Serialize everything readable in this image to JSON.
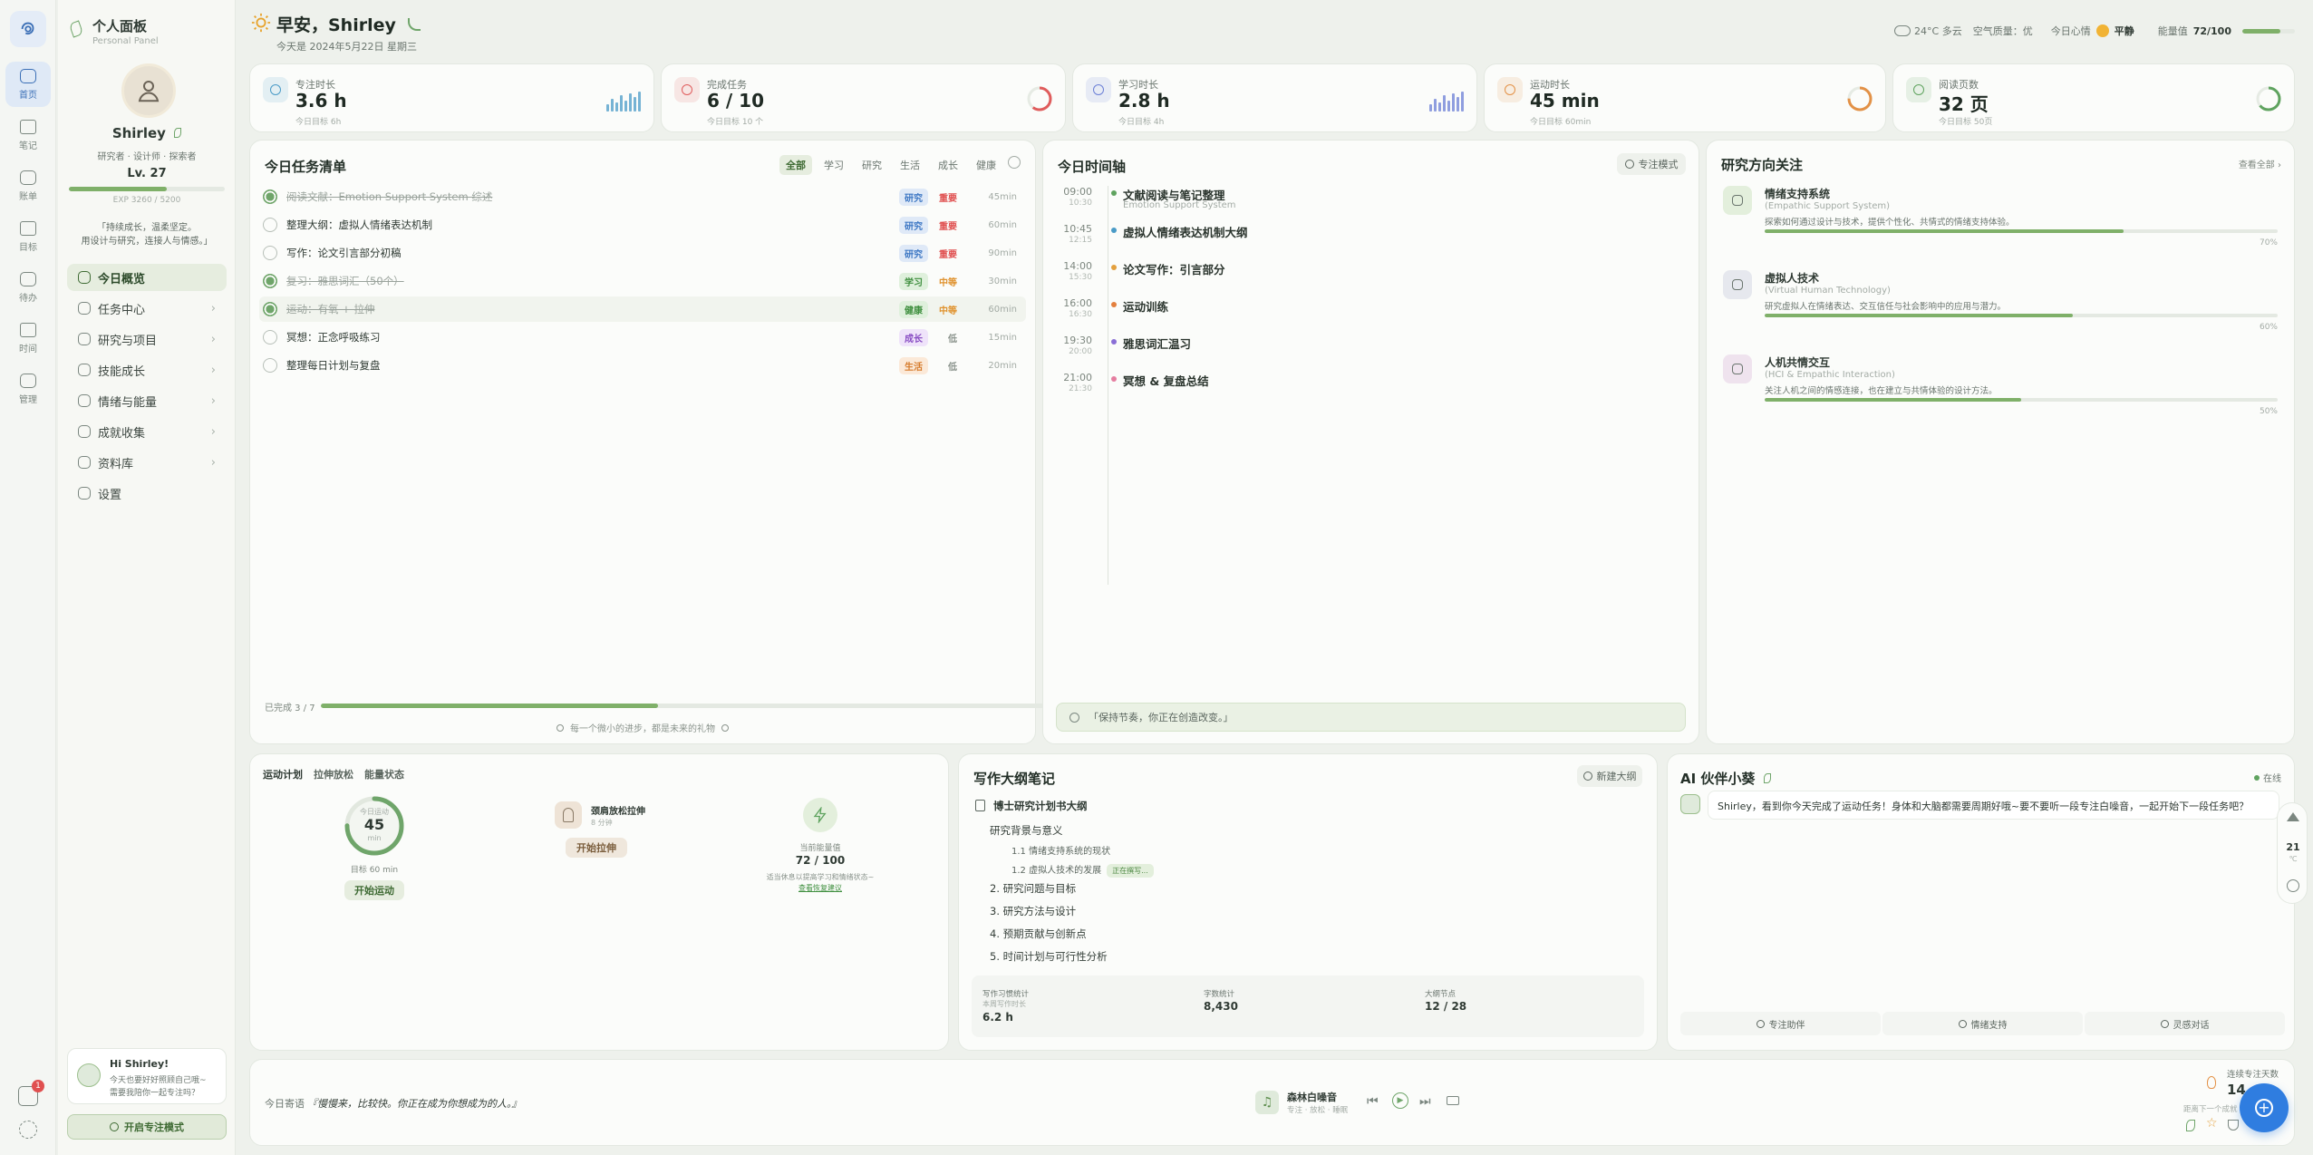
{
  "nav_rail": {
    "items": [
      {
        "label": "首页",
        "icon": "home-icon"
      },
      {
        "label": "笔记",
        "icon": "note-icon"
      },
      {
        "label": "账单",
        "icon": "wallet-icon"
      },
      {
        "label": "目标",
        "icon": "target-icon"
      },
      {
        "label": "待办",
        "icon": "check-icon"
      },
      {
        "label": "时间",
        "icon": "calendar-icon"
      },
      {
        "label": "管理",
        "icon": "shield-icon"
      }
    ],
    "notification_count": "1"
  },
  "sidebar": {
    "title": "个人面板",
    "subtitle": "Personal Panel",
    "profile": {
      "name": "Shirley",
      "roles": "研究者 · 设计师 · 探索者",
      "level": "Lv. 27",
      "exp_text": "EXP 3260 / 5200",
      "exp_fraction": 0.63,
      "motto_line1": "「持续成长，温柔坚定。",
      "motto_line2": "用设计与研究，连接人与情感。」"
    },
    "menu": [
      {
        "label": "今日概览",
        "icon": "home-icon",
        "active": true
      },
      {
        "label": "任务中心",
        "icon": "list-icon",
        "active": false
      },
      {
        "label": "研究与项目",
        "icon": "folder-icon",
        "active": false
      },
      {
        "label": "技能成长",
        "icon": "book-icon",
        "active": false
      },
      {
        "label": "情绪与能量",
        "icon": "heart-icon",
        "active": false
      },
      {
        "label": "成就收集",
        "icon": "medal-icon",
        "active": false
      },
      {
        "label": "资料库",
        "icon": "document-icon",
        "active": false
      },
      {
        "label": "设置",
        "icon": "gear-icon",
        "active": false
      }
    ],
    "companion_card": {
      "greeting": "Hi Shirley!",
      "line1": "今天也要好好照顾自己哦~",
      "line2": "需要我陪你一起专注吗？"
    },
    "focus_button": "开启专注模式"
  },
  "header": {
    "greeting": "早安，Shirley",
    "date": "今天是 2024年5月22日 星期三",
    "weather": "24°C 多云",
    "air_quality": "空气质量：优",
    "mood_label": "今日心情",
    "mood_value": "平静",
    "energy_label": "能量值",
    "energy_value": "72/100",
    "energy_fraction": 0.72
  },
  "stats": [
    {
      "label": "专注时长",
      "value": "3.6 h",
      "sub": "今日目标 6h",
      "icon": "clock-icon",
      "color": "#4a9bc7",
      "viz": "bars"
    },
    {
      "label": "完成任务",
      "value": "6 / 10",
      "sub": "今日目标 10 个",
      "icon": "heart-icon",
      "color": "#e05c5c",
      "viz": "ring",
      "fraction": 0.6
    },
    {
      "label": "学习时长",
      "value": "2.8 h",
      "sub": "今日目标 4h",
      "icon": "book-icon",
      "color": "#6b7fd6",
      "viz": "bars"
    },
    {
      "label": "运动时长",
      "value": "45 min",
      "sub": "今日目标 60min",
      "icon": "run-icon",
      "color": "#e39146",
      "viz": "ring",
      "fraction": 0.75
    },
    {
      "label": "阅读页数",
      "value": "32 页",
      "sub": "今日目标 50页",
      "icon": "book-open-icon",
      "color": "#5fa35f",
      "viz": "ring",
      "fraction": 0.64
    }
  ],
  "tasks": {
    "title": "今日任务清单",
    "tabs": [
      "全部",
      "学习",
      "研究",
      "生活",
      "成长",
      "健康"
    ],
    "active_tab": "全部",
    "items": [
      {
        "text": "阅读文献：Emotion Support System 综述",
        "tag": "研究",
        "tag_color": "#3e78c4",
        "tag_bg": "#dfe9f7",
        "priority": "重要",
        "priority_color": "#e05050",
        "minutes": "45min",
        "done": true
      },
      {
        "text": "整理大纲：虚拟人情绪表达机制",
        "tag": "研究",
        "tag_color": "#3e78c4",
        "tag_bg": "#dfe9f7",
        "priority": "重要",
        "priority_color": "#e05050",
        "minutes": "60min",
        "done": false
      },
      {
        "text": "写作：论文引言部分初稿",
        "tag": "研究",
        "tag_color": "#3e78c4",
        "tag_bg": "#dfe9f7",
        "priority": "重要",
        "priority_color": "#e05050",
        "minutes": "90min",
        "done": false
      },
      {
        "text": "复习：雅思词汇（50个）",
        "tag": "学习",
        "tag_color": "#3f8f3f",
        "tag_bg": "#dff0dc",
        "priority": "中等",
        "priority_color": "#e0922e",
        "minutes": "30min",
        "done": true
      },
      {
        "text": "运动：有氧 + 拉伸",
        "tag": "健康",
        "tag_color": "#3f8f3f",
        "tag_bg": "#dff0dc",
        "priority": "中等",
        "priority_color": "#e0922e",
        "minutes": "60min",
        "done": true
      },
      {
        "text": "冥想：正念呼吸练习",
        "tag": "成长",
        "tag_color": "#8a4fc4",
        "tag_bg": "#efe3fa",
        "priority": "低",
        "priority_color": "#8a938c",
        "minutes": "15min",
        "done": false
      },
      {
        "text": "整理每日计划与复盘",
        "tag": "生活",
        "tag_color": "#d57a2a",
        "tag_bg": "#fbe9d8",
        "priority": "低",
        "priority_color": "#8a938c",
        "minutes": "20min",
        "done": false
      }
    ],
    "progress_label": "已完成 3 / 7",
    "progress_fraction": 0.43,
    "footer": "每一个微小的进步，都是未来的礼物"
  },
  "timeline": {
    "title": "今日时间轴",
    "focus_mode": "专注模式",
    "items": [
      {
        "start": "09:00",
        "end": "10:30",
        "title": "文献阅读与笔记整理",
        "subtitle": "Emotion Support System",
        "dot": "#5fa35f"
      },
      {
        "start": "10:45",
        "end": "12:15",
        "title": "虚拟人情绪表达机制大纲",
        "subtitle": "",
        "dot": "#4a9bc7"
      },
      {
        "start": "14:00",
        "end": "15:30",
        "title": "论文写作：引言部分",
        "subtitle": "",
        "dot": "#e3a03e"
      },
      {
        "start": "16:00",
        "end": "16:30",
        "title": "运动训练",
        "subtitle": "",
        "dot": "#e3803e"
      },
      {
        "start": "19:30",
        "end": "20:00",
        "title": "雅思词汇温习",
        "subtitle": "",
        "dot": "#8a6fd6"
      },
      {
        "start": "21:00",
        "end": "21:30",
        "title": "冥想 & 复盘总结",
        "subtitle": "",
        "dot": "#e57ea0"
      }
    ],
    "quote": "「保持节奏，你正在创造改变。」"
  },
  "research": {
    "title": "研究方向关注",
    "view_all": "查看全部",
    "items": [
      {
        "title": "情绪支持系统",
        "en": "(Empathic Support System)",
        "desc": "探索如何通过设计与技术，提供个性化、共情式的情绪支持体验。",
        "percent_label": "70%",
        "fraction": 0.7,
        "icon": "leaf-icon",
        "bg": "#e3efdc"
      },
      {
        "title": "虚拟人技术",
        "en": "(Virtual Human Technology)",
        "desc": "研究虚拟人在情绪表达、交互信任与社会影响中的应用与潜力。",
        "percent_label": "60%",
        "fraction": 0.6,
        "icon": "robot-icon",
        "bg": "#e6e8ee"
      },
      {
        "title": "人机共情交互",
        "en": "(HCI & Empathic Interaction)",
        "desc": "关注人机之间的情感连接，也在建立与共情体验的设计方法。",
        "percent_label": "50%",
        "fraction": 0.5,
        "icon": "chat-heart-icon",
        "bg": "#efe3ee"
      }
    ]
  },
  "exercise": {
    "tabs": [
      "运动计划",
      "拉伸放松",
      "能量状态"
    ],
    "ring_label": "今日运动",
    "ring_value": "45",
    "ring_unit": "min",
    "ring_fraction": 0.75,
    "goal": "目标 60 min",
    "start_button": "开始运动",
    "stretch_title": "颈肩放松拉伸",
    "stretch_time": "8 分钟",
    "stretch_button": "开始拉伸",
    "energy_label": "当前能量值",
    "energy_value": "72 / 100",
    "energy_note": "适当休息以提高学习和情绪状态~",
    "energy_link": "查看恢复建议"
  },
  "outline": {
    "title": "写作大纲笔记",
    "new_button": "新建大纲",
    "doc_title": "博士研究计划书大纲",
    "items": [
      {
        "text": "研究背景与意义",
        "level": 1
      },
      {
        "text": "1.1 情绪支持系统的现状",
        "level": 2
      },
      {
        "text": "1.2 虚拟人技术的发展",
        "level": 2,
        "badge": "正在撰写..."
      },
      {
        "text": "2. 研究问题与目标",
        "level": 1
      },
      {
        "text": "3. 研究方法与设计",
        "level": 1
      },
      {
        "text": "4. 预期贡献与创新点",
        "level": 1
      },
      {
        "text": "5. 时间计划与可行性分析",
        "level": 1
      }
    ],
    "stats": [
      {
        "label": "写作习惯统计",
        "sub": "本周写作时长",
        "value": "6.2 h"
      },
      {
        "label": "字数统计",
        "sub": "",
        "value": "8,430"
      },
      {
        "label": "大纲节点",
        "sub": "",
        "value": "12 / 28"
      }
    ]
  },
  "ai": {
    "title": "AI 伙伴小葵",
    "status": "在线",
    "message": "Shirley，看到你今天完成了运动任务！身体和大脑都需要周期好哦~要不要听一段专注白噪音，一起开始下一段任务吧？",
    "actions": [
      "专注助伴",
      "情绪支持",
      "灵感对话"
    ]
  },
  "floating": {
    "number": "21",
    "unit": "℃"
  },
  "footer": {
    "quote_label": "今日寄语",
    "quote": "『慢慢来，比较快。你正在成为你想成为的人。』",
    "music_title": "森林白噪音",
    "music_sub": "专注 · 放松 · 睡眠",
    "streak_label": "连续专注天数",
    "streak_value": "14",
    "streak_note": "距离下一个成就"
  }
}
